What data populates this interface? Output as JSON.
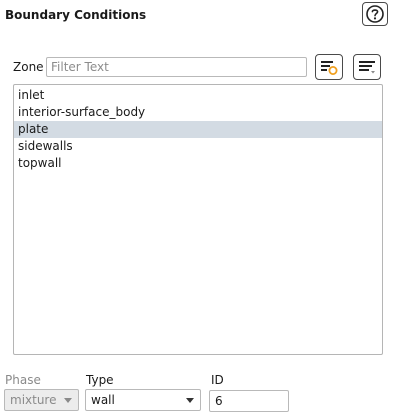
{
  "panel": {
    "title": "Boundary Conditions"
  },
  "zone": {
    "label": "Zone",
    "filter_placeholder": "Filter Text",
    "filter_value": ""
  },
  "zone_list": {
    "items": [
      "inlet",
      "interior-surface_body",
      "plate",
      "sidewalls",
      "topwall"
    ],
    "selected": "plate"
  },
  "phase": {
    "label": "Phase",
    "value": "mixture",
    "enabled": false
  },
  "type": {
    "label": "Type",
    "value": "wall"
  },
  "id": {
    "label": "ID",
    "value": "6"
  },
  "icons": {
    "help": "help-icon",
    "filter_zones": "filter-zones-icon",
    "sort": "sort-menu-icon"
  },
  "colors": {
    "selected_row": "#d3dbe3",
    "accent_orange": "#f0a020",
    "disabled_text": "#8a8a8a"
  }
}
